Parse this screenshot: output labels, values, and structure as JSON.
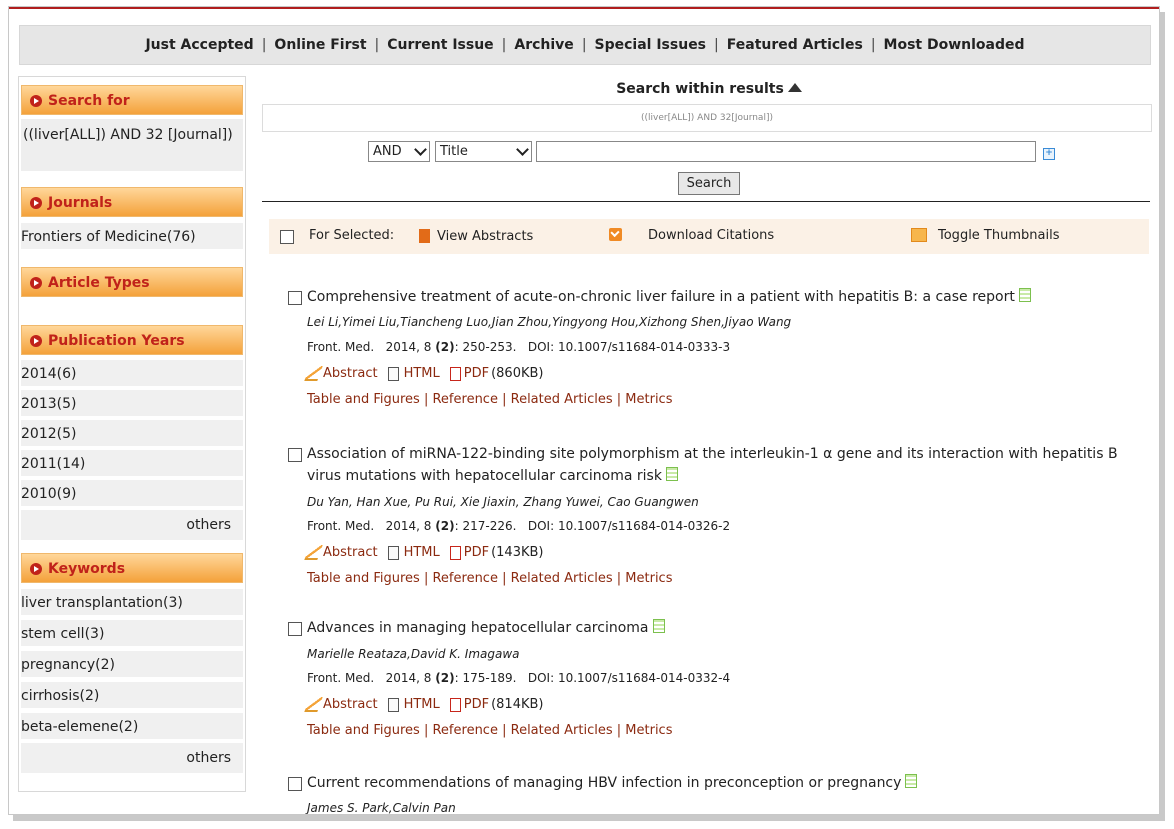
{
  "nav": [
    "Just Accepted",
    "Online First",
    "Current Issue",
    "Archive",
    "Special Issues",
    "Featured Articles",
    "Most Downloaded"
  ],
  "sidebar": {
    "search_for": {
      "title": "Search for",
      "query": "((liver[ALL]) AND 32 [Journal])"
    },
    "journals": {
      "title": "Journals",
      "items": [
        "Frontiers of Medicine(76)"
      ]
    },
    "article_types": {
      "title": "Article Types"
    },
    "publication_years": {
      "title": "Publication Years",
      "items": [
        "2014(6)",
        "2013(5)",
        "2012(5)",
        "2011(14)",
        "2010(9)"
      ],
      "others": "others"
    },
    "keywords": {
      "title": "Keywords",
      "items": [
        "liver transplantation(3)",
        "stem cell(3)",
        "pregnancy(2)",
        "cirrhosis(2)",
        "beta-elemene(2)"
      ],
      "others": "others"
    }
  },
  "search_panel": {
    "title": "Search within results",
    "query": "((liver[ALL]) AND 32[Journal])",
    "operator": "AND",
    "field": "Title",
    "input_value": "",
    "button": "Search"
  },
  "toolbar": {
    "for_selected": "For Selected:",
    "view_abstracts": "View Abstracts",
    "download_citations": "Download Citations",
    "toggle_thumbnails": "Toggle Thumbnails"
  },
  "links_labels": {
    "abstract": "Abstract",
    "html": "HTML",
    "pdf": "PDF",
    "table": "Table and Figures",
    "reference": "Reference",
    "related": "Related Articles",
    "metrics": "Metrics",
    "sep": "|"
  },
  "articles": [
    {
      "title": "Comprehensive treatment of acute-on-chronic liver failure in a patient with hepatitis B: a case report",
      "authors": "Lei Li,Yimei Liu,Tiancheng Luo,Jian Zhou,Yingyong Hou,Xizhong Shen,Jiyao Wang",
      "journal": "Front. Med.",
      "year": "2014",
      "vol": "8",
      "issue": "(2)",
      "pages": "250-253.",
      "doi": "DOI: 10.1007/s11684-014-0333-3",
      "pdf_size": "(860KB)"
    },
    {
      "title": "Association of miRNA-122-binding site polymorphism at the interleukin-1 α gene and its interaction with hepatitis B virus mutations with hepatocellular carcinoma risk",
      "authors": "Du Yan, Han Xue, Pu Rui, Xie Jiaxin, Zhang Yuwei, Cao Guangwen",
      "journal": "Front. Med.",
      "year": "2014",
      "vol": "8",
      "issue": "(2)",
      "pages": "217-226.",
      "doi": "DOI: 10.1007/s11684-014-0326-2",
      "pdf_size": "(143KB)"
    },
    {
      "title": "Advances in managing hepatocellular carcinoma",
      "authors": "Marielle Reataza,David K. Imagawa",
      "journal": "Front. Med.",
      "year": "2014",
      "vol": "8",
      "issue": "(2)",
      "pages": "175-189.",
      "doi": "DOI: 10.1007/s11684-014-0332-4",
      "pdf_size": "(814KB)"
    },
    {
      "title": "Current recommendations of managing HBV infection in preconception or pregnancy",
      "authors": "James S. Park,Calvin Pan"
    }
  ]
}
